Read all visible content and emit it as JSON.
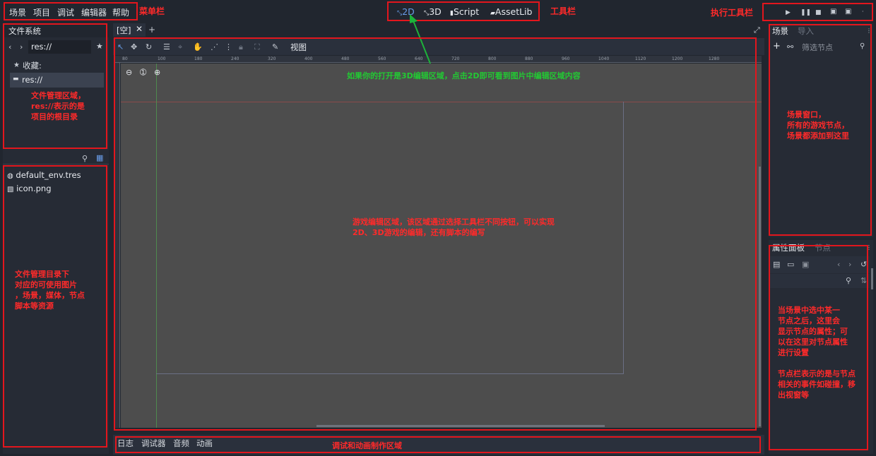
{
  "menu": {
    "items": [
      "场景",
      "项目",
      "调试",
      "编辑器",
      "帮助"
    ]
  },
  "toolbar": {
    "mode_2d": "2D",
    "mode_3d": "3D",
    "mode_script": "Script",
    "mode_assetlib": "AssetLib"
  },
  "filesystem": {
    "tab": "文件系统",
    "path": "res://",
    "favorites": "收藏:",
    "res_item": "res://",
    "files": [
      "default_env.tres",
      "icon.png"
    ]
  },
  "editor": {
    "tab": "[空]",
    "view_menu": "视图",
    "ruler_ticks": [
      "80",
      "100",
      "180",
      "240",
      "320",
      "400",
      "480",
      "560",
      "640",
      "720",
      "800",
      "880",
      "960",
      "1040",
      "1120",
      "1200",
      "1280"
    ]
  },
  "scene": {
    "tab_scene": "场景",
    "tab_import": "导入",
    "filter_placeholder": "筛选节点"
  },
  "inspector": {
    "tab_inspector": "属性面板",
    "tab_node": "节点"
  },
  "bottom": {
    "tabs": [
      "日志",
      "调试器",
      "音频",
      "动画"
    ]
  },
  "annotations": {
    "menubar": "菜单栏",
    "toolbar": "工具栏",
    "run_toolbar": "执行工具栏",
    "fs_area": "文件管理区域，\nres://表示的是\n项目的根目录",
    "fs_list": "文件管理目录下\n对应的可使用图片\n，场景，媒体，节点\n脚本等资源",
    "hint_2d": "如果你的打开是3D编辑区域，点击2D即可看到图片中编辑区域内容",
    "editor_area": "游戏编辑区域，该区域通过选择工具栏不同按钮，可以实现\n2D、3D游戏的编辑，还有脚本的编写",
    "scene_area": "场景窗口，\n所有的游戏节点，\n场景都添加到这里",
    "inspector_area": "当场景中选中某一\n节点之后，这里会\n显示节点的属性；可\n以在这里对节点属性\n进行设置\n\n节点栏表示的是与节点\n相关的事件如碰撞，移\n出视窗等",
    "bottom_area": "调试和动画制作区域"
  },
  "colors": {
    "background": "#21262f",
    "panel": "#2a303c",
    "viewport": "#4d4d4d",
    "annotation": "#e3161d",
    "arrow": "#1db33a",
    "accent": "#699ce8"
  }
}
